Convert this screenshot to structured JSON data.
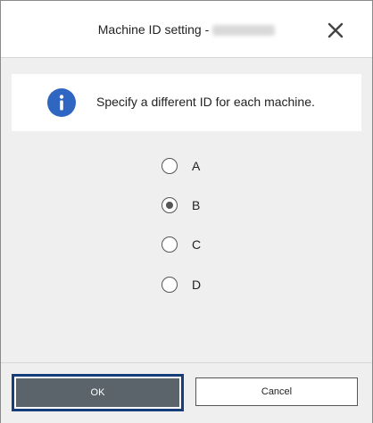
{
  "dialog": {
    "title": "Machine ID setting -",
    "close_icon": "close-icon"
  },
  "info": {
    "icon": "info-icon",
    "text": "Specify a different ID for each machine."
  },
  "options": [
    {
      "label": "A",
      "selected": false
    },
    {
      "label": "B",
      "selected": true
    },
    {
      "label": "C",
      "selected": false
    },
    {
      "label": "D",
      "selected": false
    }
  ],
  "buttons": {
    "ok": "OK",
    "cancel": "Cancel"
  },
  "colors": {
    "accent": "#2f66c1",
    "ok_bg": "#5c646b",
    "focus_border": "#163e7a"
  }
}
